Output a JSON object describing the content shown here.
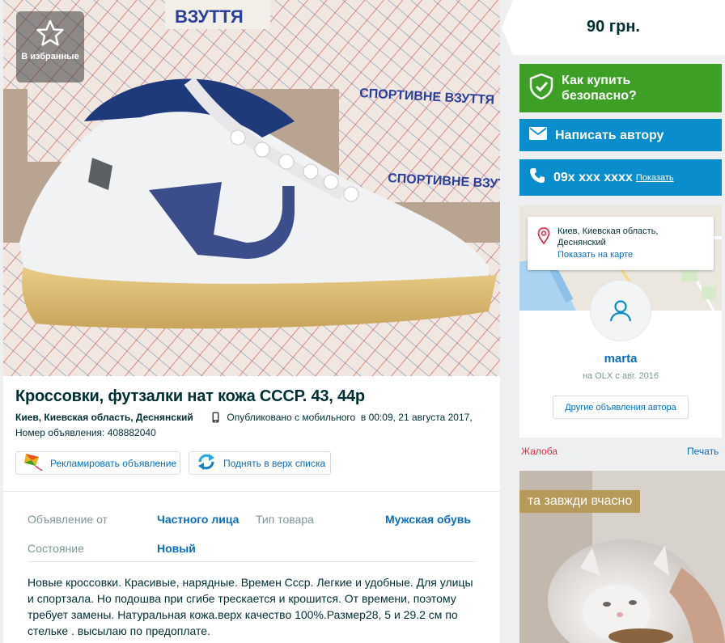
{
  "gallery": {
    "favorite_label": "В избранные",
    "boxes": [
      {
        "text": "ВЗУТТЯ"
      },
      {
        "text": "СПОРТИВНЕ ВЗУТТЯ"
      },
      {
        "text": "СПОРТИВНЕ ВЗУТТЯ"
      }
    ]
  },
  "listing": {
    "title": "Кроссовки, футзалки нат кожа СССР. 43, 44р",
    "location": "Киев, Киевская область, Деснянский",
    "published": "Опубликовано с мобильного",
    "date": "в 00:09, 21 августа 2017,",
    "ad_number": "Номер объявления: 408882040",
    "promote_label": "Рекламировать объявление",
    "bump_label": "Поднять в верх списка",
    "params": [
      {
        "key": "Объявление от",
        "value": "Частного лица"
      },
      {
        "key": "Тип товара",
        "value": "Мужская обувь"
      },
      {
        "key": "Состояние",
        "value": "Новый"
      }
    ],
    "description": "Новые кроссовки. Красивые, нарядные. Времен Ссср. Легкие и удобные. Для улицы и спортзала. Но подошва при сгибе трескается и крошится. От времени, поэтому требует замены. Натуральная кожа.верх качество 100%.Размер28, 5 и 29.2 см по стельке . высылаю по предоплате."
  },
  "sidebar": {
    "price": "90 грн.",
    "safe_buy_label": "Как купить безопасно?",
    "message_label": "Написать автору",
    "phone_label": "09x xxx xxxx",
    "phone_show": "Показать",
    "address": "Киев, Киевская область, Деснянский",
    "show_on_map": "Показать на карте",
    "user_name": "marta",
    "member_since": "на OLX с авг. 2016",
    "other_ads_label": "Другие объявления автора",
    "complaint_label": "Жалоба",
    "print_label": "Печать",
    "ad_banner_text": "та завжди вчасно"
  },
  "colors": {
    "green_button": "#3d9f26",
    "blue_button": "#0a8dcd",
    "link": "#0a6ebd",
    "complaint": "#e2314a"
  }
}
